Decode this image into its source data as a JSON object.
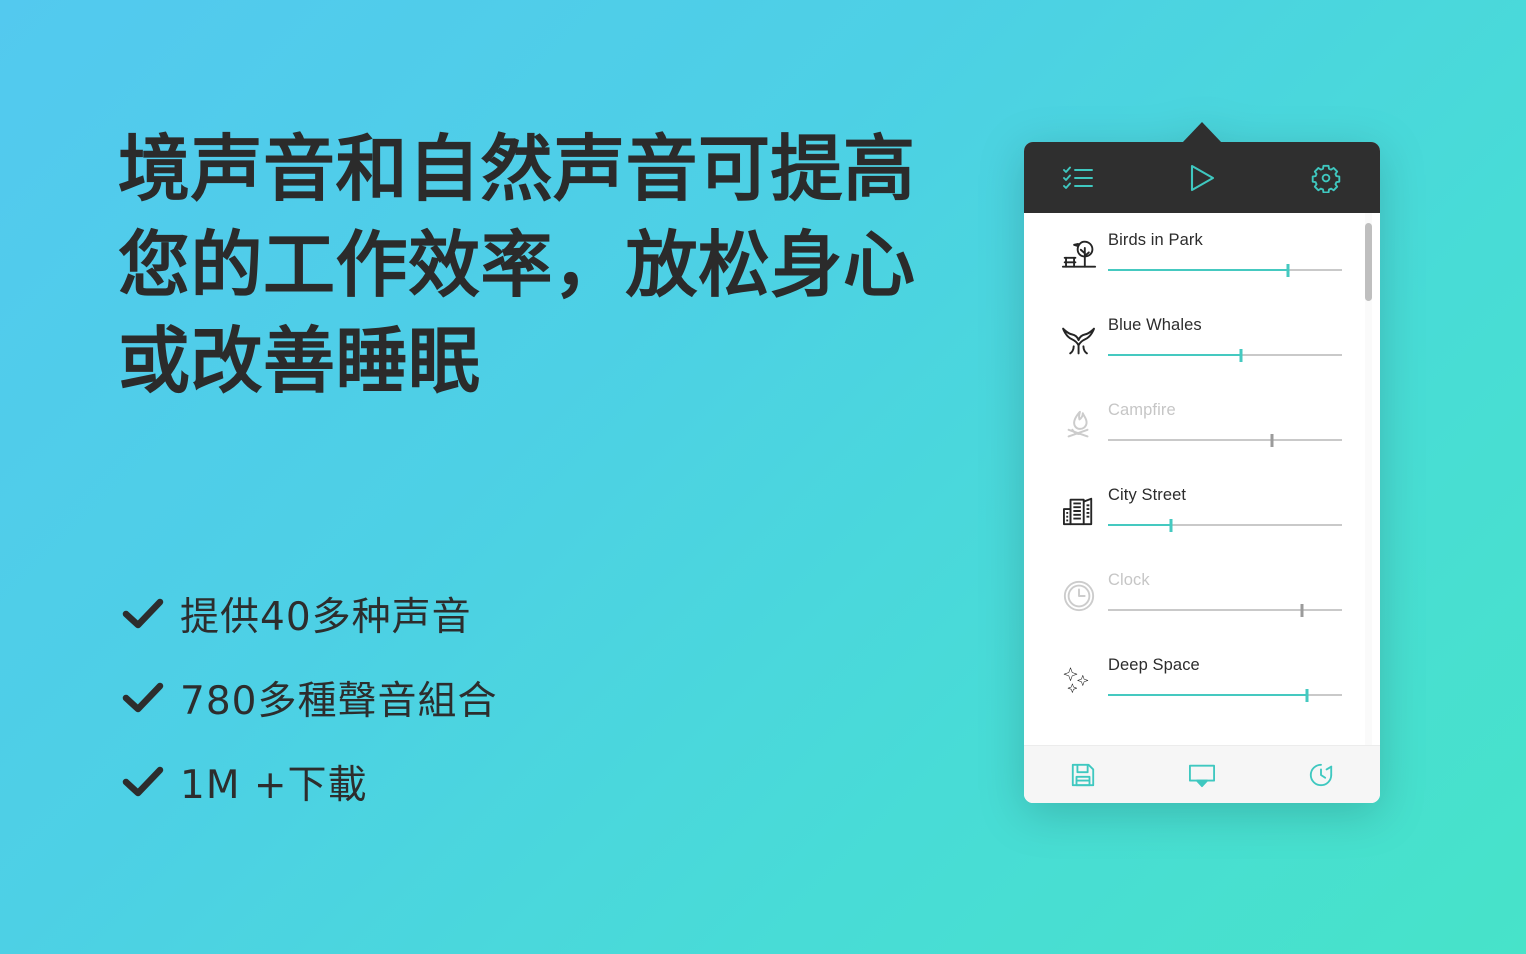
{
  "colors": {
    "bg_start": "#53c9ef",
    "bg_end": "#47e3c9",
    "accent_teal": "#45c9c0",
    "header_dark": "#2f2f2f",
    "text_dark": "#2d2d2d",
    "text_disabled": "#c6c6c6",
    "track_grey": "#c9c9c9"
  },
  "marketing": {
    "headline": "境声音和自然声音可提高您的工作效率，放松身心或改善睡眠",
    "bullets": [
      {
        "icon": "check-icon",
        "text": "提供40多种声音"
      },
      {
        "icon": "check-icon",
        "text": "780多種聲音組合"
      },
      {
        "icon": "check-icon",
        "text": "1M +下載"
      }
    ]
  },
  "app": {
    "header": {
      "buttons": [
        {
          "name": "checklist-icon",
          "label": "Sound list"
        },
        {
          "name": "play-icon",
          "label": "Play"
        },
        {
          "name": "gear-icon",
          "label": "Settings"
        }
      ]
    },
    "sounds": [
      {
        "name": "Birds in Park",
        "icon": "tree-bench-icon",
        "volume": 77,
        "enabled": true
      },
      {
        "name": "Blue Whales",
        "icon": "whale-tail-icon",
        "volume": 57,
        "enabled": true
      },
      {
        "name": "Campfire",
        "icon": "campfire-icon",
        "volume": 70,
        "enabled": false
      },
      {
        "name": "City Street",
        "icon": "buildings-icon",
        "volume": 27,
        "enabled": true
      },
      {
        "name": "Clock",
        "icon": "clock-icon",
        "volume": 83,
        "enabled": false
      },
      {
        "name": "Deep Space",
        "icon": "sparkles-icon",
        "volume": 85,
        "enabled": true
      }
    ],
    "footer": {
      "buttons": [
        {
          "name": "save-icon",
          "label": "Save mix"
        },
        {
          "name": "cast-icon",
          "label": "Cast"
        },
        {
          "name": "timer-icon",
          "label": "Timer"
        }
      ]
    },
    "scrollbar": {
      "thumb_top_pct": 2,
      "thumb_height_pct": 15
    }
  }
}
